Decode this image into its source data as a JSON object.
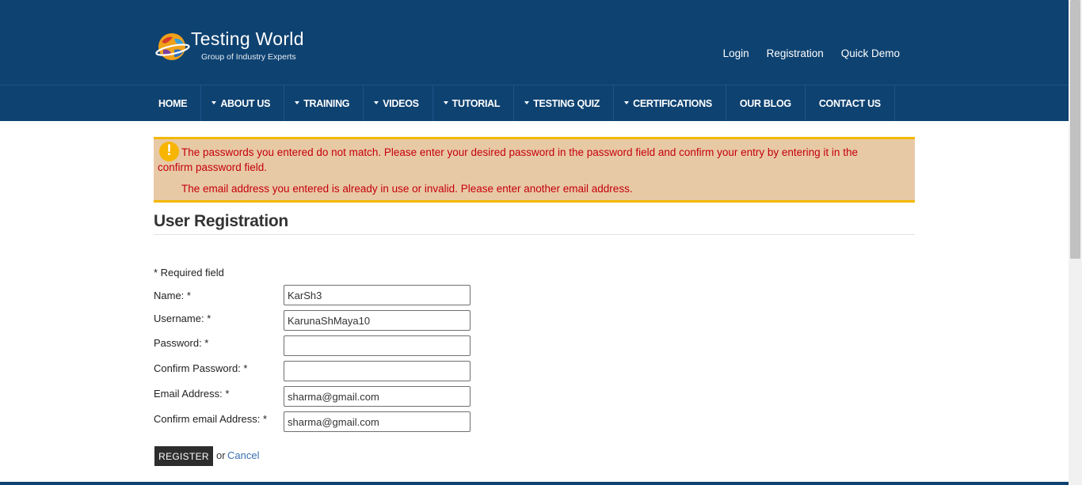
{
  "header": {
    "logo_title": "Testing World",
    "logo_subtitle": "Group of Industry Experts",
    "links": [
      "Login",
      "Registration",
      "Quick Demo"
    ]
  },
  "nav": {
    "items": [
      {
        "label": "HOME",
        "dropdown": false
      },
      {
        "label": "ABOUT US",
        "dropdown": true
      },
      {
        "label": "TRAINING",
        "dropdown": true
      },
      {
        "label": "VIDEOS",
        "dropdown": true
      },
      {
        "label": "TUTORIAL",
        "dropdown": true
      },
      {
        "label": "TESTING QUIZ",
        "dropdown": true
      },
      {
        "label": "CERTIFICATIONS",
        "dropdown": true
      },
      {
        "label": "OUR BLOG",
        "dropdown": false
      },
      {
        "label": "CONTACT US",
        "dropdown": false
      }
    ]
  },
  "errors": {
    "icon": "warning-icon",
    "password_mismatch": "The passwords you entered do not match. Please enter your desired password in the password field and confirm your entry by entering it in the confirm password field.",
    "email_in_use": "The email address you entered is already in use or invalid. Please enter another email address."
  },
  "form": {
    "title": "User Registration",
    "required_note": "* Required field",
    "fields": [
      {
        "label": "Name: *",
        "value": "KarSh3",
        "type": "text"
      },
      {
        "label": "Username: *",
        "value": "KarunaShMaya10",
        "type": "text"
      },
      {
        "label": "Password: *",
        "value": "",
        "type": "password"
      },
      {
        "label": "Confirm Password: *",
        "value": "",
        "type": "password"
      },
      {
        "label": "Email Address: *",
        "value": "sharma@gmail.com",
        "type": "text"
      },
      {
        "label": "Confirm email Address: *",
        "value": "sharma@gmail.com",
        "type": "text"
      }
    ],
    "register_label": "REGISTER",
    "or_text": "or",
    "cancel_label": "Cancel"
  },
  "colors": {
    "header_bg": "#0e4271",
    "error_bg": "#e8c9a6",
    "error_border": "#f3b800",
    "error_text": "#c4000c",
    "button_bg": "#2d2d2d",
    "link": "#3a6fb0"
  }
}
